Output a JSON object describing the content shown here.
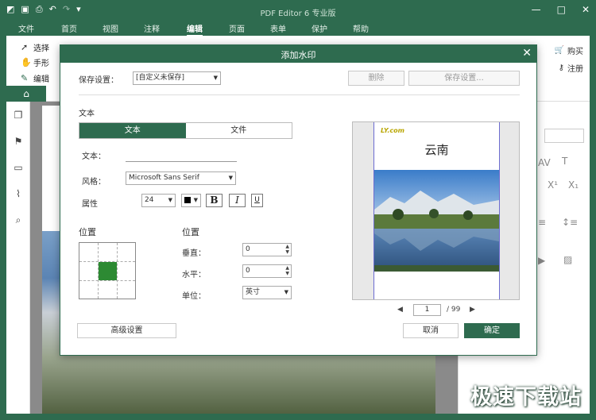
{
  "app": {
    "title": "PDF Editor 6 专业版",
    "menu": [
      "文件",
      "首页",
      "视图",
      "注释",
      "编辑",
      "页面",
      "表单",
      "保护",
      "帮助"
    ],
    "active_menu": "编辑"
  },
  "ribbon": {
    "select": "选择",
    "hand": "手形",
    "edit": "编辑",
    "buy": "购买",
    "register": "注册"
  },
  "dialog": {
    "title": "添加水印",
    "save_settings_label": "保存设置：",
    "preset_value": "[自定义未保存]",
    "delete_button": "删除",
    "save_settings_button": "保存设置...",
    "section_text": "文本",
    "tabs": [
      "文本",
      "文件"
    ],
    "text_label": "文本：",
    "text_value": "",
    "style_label": "风格：",
    "font_value": "Microsoft Sans Serif",
    "attr_label": "属性",
    "font_size": "24",
    "bold": "B",
    "italic": "I",
    "underline": "U",
    "position_title_left": "位置",
    "position_title_right": "位置",
    "vertical_label": "垂直：",
    "vertical_value": "0",
    "horizontal_label": "水平：",
    "horizontal_value": "0",
    "unit_label": "单位：",
    "unit_value": "英寸",
    "advanced_button": "高级设置",
    "cancel_button": "取消",
    "ok_button": "确定",
    "preview": {
      "logo": "LY.com",
      "heading": "云南",
      "current_page": "1",
      "total_pages": "/ 99"
    }
  },
  "site_watermark": "极速下载站",
  "colors": {
    "brand_green": "#2e6b4f",
    "position_selected": "#2d8a33"
  }
}
